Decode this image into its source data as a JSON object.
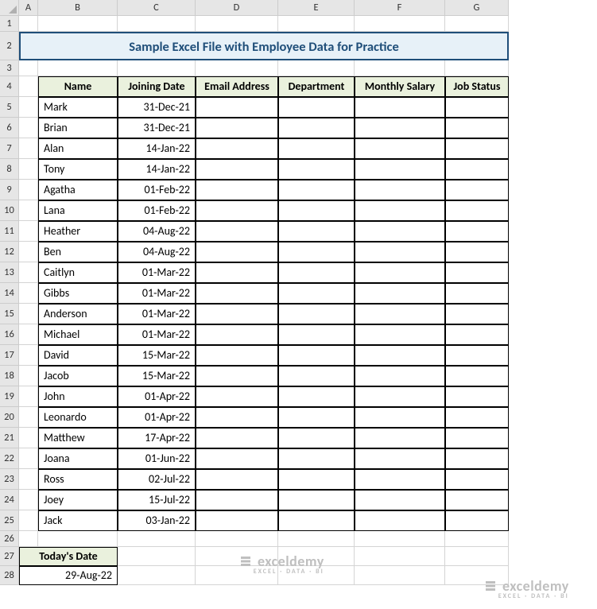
{
  "columns": [
    "A",
    "B",
    "C",
    "D",
    "E",
    "F",
    "G"
  ],
  "title": "Sample Excel File with Employee Data for Practice",
  "headers": {
    "name": "Name",
    "joining": "Joining Date",
    "email": "Email Address",
    "dept": "Department",
    "salary": "Monthly Salary",
    "status": "Job Status"
  },
  "rows": [
    {
      "name": "Mark",
      "date": "31-Dec-21"
    },
    {
      "name": "Brian",
      "date": "31-Dec-21"
    },
    {
      "name": "Alan",
      "date": "14-Jan-22"
    },
    {
      "name": "Tony",
      "date": "14-Jan-22"
    },
    {
      "name": "Agatha",
      "date": "01-Feb-22"
    },
    {
      "name": "Lana",
      "date": "01-Feb-22"
    },
    {
      "name": "Heather",
      "date": "04-Aug-22"
    },
    {
      "name": "Ben",
      "date": "04-Aug-22"
    },
    {
      "name": "Caitlyn",
      "date": "01-Mar-22"
    },
    {
      "name": "Gibbs",
      "date": "01-Mar-22"
    },
    {
      "name": "Anderson",
      "date": "01-Mar-22"
    },
    {
      "name": "Michael",
      "date": "01-Mar-22"
    },
    {
      "name": "David",
      "date": "15-Mar-22"
    },
    {
      "name": "Jacob",
      "date": "15-Mar-22"
    },
    {
      "name": "John",
      "date": "01-Apr-22"
    },
    {
      "name": "Leonardo",
      "date": "01-Apr-22"
    },
    {
      "name": "Matthew",
      "date": "17-Apr-22"
    },
    {
      "name": "Joana",
      "date": "01-Jun-22"
    },
    {
      "name": "Ross",
      "date": "02-Jul-22"
    },
    {
      "name": "Joey",
      "date": "15-Jul-22"
    },
    {
      "name": "Jack",
      "date": "03-Jan-22"
    }
  ],
  "today": {
    "label": "Today's Date",
    "value": "29-Aug-22"
  },
  "watermark": {
    "main": "exceldemy",
    "sub": "EXCEL · DATA · BI"
  },
  "chart_data": {
    "type": "table",
    "title": "Sample Excel File with Employee Data for Practice",
    "columns": [
      "Name",
      "Joining Date",
      "Email Address",
      "Department",
      "Monthly Salary",
      "Job Status"
    ],
    "data": [
      [
        "Mark",
        "31-Dec-21",
        "",
        "",
        "",
        ""
      ],
      [
        "Brian",
        "31-Dec-21",
        "",
        "",
        "",
        ""
      ],
      [
        "Alan",
        "14-Jan-22",
        "",
        "",
        "",
        ""
      ],
      [
        "Tony",
        "14-Jan-22",
        "",
        "",
        "",
        ""
      ],
      [
        "Agatha",
        "01-Feb-22",
        "",
        "",
        "",
        ""
      ],
      [
        "Lana",
        "01-Feb-22",
        "",
        "",
        "",
        ""
      ],
      [
        "Heather",
        "04-Aug-22",
        "",
        "",
        "",
        ""
      ],
      [
        "Ben",
        "04-Aug-22",
        "",
        "",
        "",
        ""
      ],
      [
        "Caitlyn",
        "01-Mar-22",
        "",
        "",
        "",
        ""
      ],
      [
        "Gibbs",
        "01-Mar-22",
        "",
        "",
        "",
        ""
      ],
      [
        "Anderson",
        "01-Mar-22",
        "",
        "",
        "",
        ""
      ],
      [
        "Michael",
        "01-Mar-22",
        "",
        "",
        "",
        ""
      ],
      [
        "David",
        "15-Mar-22",
        "",
        "",
        "",
        ""
      ],
      [
        "Jacob",
        "15-Mar-22",
        "",
        "",
        "",
        ""
      ],
      [
        "John",
        "01-Apr-22",
        "",
        "",
        "",
        ""
      ],
      [
        "Leonardo",
        "01-Apr-22",
        "",
        "",
        "",
        ""
      ],
      [
        "Matthew",
        "17-Apr-22",
        "",
        "",
        "",
        ""
      ],
      [
        "Joana",
        "01-Jun-22",
        "",
        "",
        "",
        ""
      ],
      [
        "Ross",
        "02-Jul-22",
        "",
        "",
        "",
        ""
      ],
      [
        "Joey",
        "15-Jul-22",
        "",
        "",
        "",
        ""
      ],
      [
        "Jack",
        "03-Jan-22",
        "",
        "",
        "",
        ""
      ]
    ],
    "footer": {
      "Today's Date": "29-Aug-22"
    }
  }
}
